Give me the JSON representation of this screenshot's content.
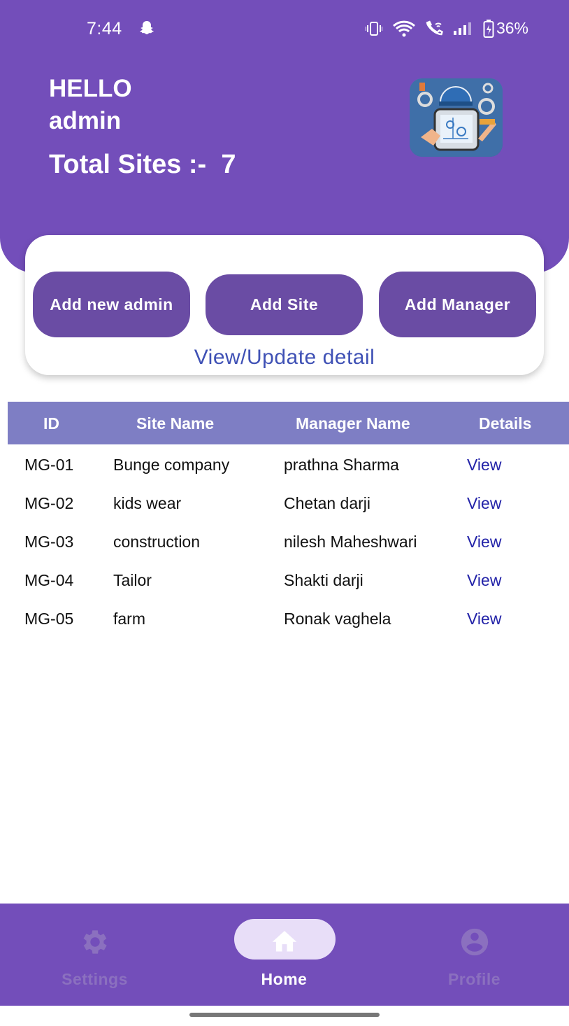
{
  "status_bar": {
    "time": "7:44",
    "battery": "36%",
    "icons": [
      "snapchat-ghost-icon",
      "vibrate-icon",
      "wifi-icon",
      "wifi-calling-icon",
      "signal-icon",
      "battery-charging-icon"
    ]
  },
  "header": {
    "greeting": "HELLO",
    "username": "admin",
    "total_sites": "Total Sites :-  7",
    "logo_icon": "engineer-blueprint-logo"
  },
  "actions": {
    "add_admin": "Add new admin",
    "add_site": "Add Site",
    "add_manager": "Add Manager",
    "view_update": "View/Update detail"
  },
  "table": {
    "headers": {
      "id": "ID",
      "site_name": "Site Name",
      "manager_name": "Manager Name",
      "details": "Details"
    },
    "rows": [
      {
        "id": "MG-01",
        "site": "Bunge company",
        "manager": "prathna Sharma",
        "details": "View"
      },
      {
        "id": "MG-02",
        "site": "kids wear",
        "manager": "Chetan darji",
        "details": "View"
      },
      {
        "id": "MG-03",
        "site": "construction",
        "manager": "nilesh Maheshwari",
        "details": "View"
      },
      {
        "id": "MG-04",
        "site": "Tailor",
        "manager": "Shakti darji",
        "details": "View"
      },
      {
        "id": "MG-05",
        "site": "farm",
        "manager": "Ronak vaghela",
        "details": "View"
      }
    ]
  },
  "bottom_nav": {
    "items": [
      {
        "label": "Settings",
        "icon": "gear-icon",
        "active": false
      },
      {
        "label": "Home",
        "icon": "home-icon",
        "active": true
      },
      {
        "label": "Profile",
        "icon": "account-circle-icon",
        "active": false
      }
    ]
  },
  "colors": {
    "primary": "#734EBA",
    "button": "#6A4CA4",
    "table_header": "#7E7EC4",
    "link": "#2323A8",
    "view_update": "#3F51B5",
    "nav_pill": "#E8DEF8"
  }
}
